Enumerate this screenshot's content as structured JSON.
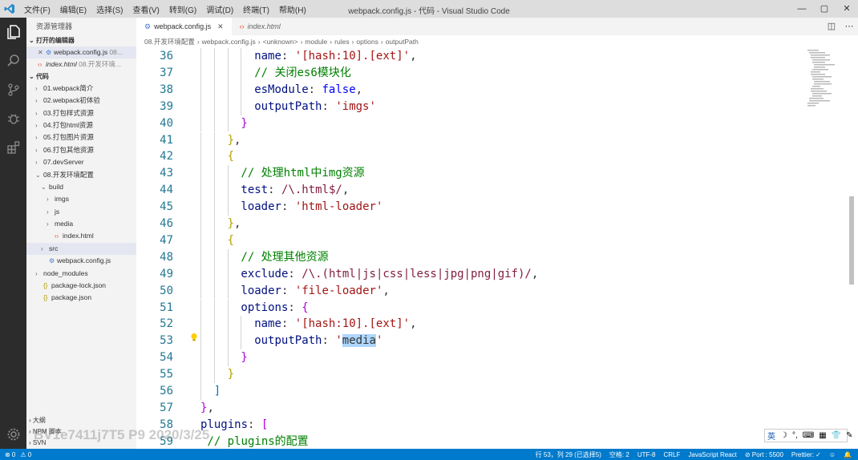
{
  "titlebar": {
    "menu": [
      "文件(F)",
      "编辑(E)",
      "选择(S)",
      "查看(V)",
      "转到(G)",
      "调试(D)",
      "终端(T)",
      "帮助(H)"
    ],
    "title": "webpack.config.js - 代码 - Visual Studio Code"
  },
  "sidebar": {
    "title": "资源管理器",
    "open_editors_label": "打开的编辑器",
    "open_editors": [
      {
        "name": "webpack.config.js",
        "path": "08..."
      },
      {
        "name": "index.html",
        "path": "08.开发环境..."
      }
    ],
    "workspace_label": "代码",
    "tree": [
      {
        "label": "01.webpack简介",
        "indent": 1,
        "chevron": "›",
        "icon": ""
      },
      {
        "label": "02.webpack初体验",
        "indent": 1,
        "chevron": "›",
        "icon": ""
      },
      {
        "label": "03.打包样式资源",
        "indent": 1,
        "chevron": "›",
        "icon": ""
      },
      {
        "label": "04.打包html资源",
        "indent": 1,
        "chevron": "›",
        "icon": ""
      },
      {
        "label": "05.打包图片资源",
        "indent": 1,
        "chevron": "›",
        "icon": ""
      },
      {
        "label": "06.打包其他资源",
        "indent": 1,
        "chevron": "›",
        "icon": ""
      },
      {
        "label": "07.devServer",
        "indent": 1,
        "chevron": "›",
        "icon": ""
      },
      {
        "label": "08.开发环境配置",
        "indent": 1,
        "chevron": "⌄",
        "icon": ""
      },
      {
        "label": "build",
        "indent": 2,
        "chevron": "⌄",
        "icon": ""
      },
      {
        "label": "imgs",
        "indent": 3,
        "chevron": "›",
        "icon": ""
      },
      {
        "label": "js",
        "indent": 3,
        "chevron": "›",
        "icon": ""
      },
      {
        "label": "media",
        "indent": 3,
        "chevron": "›",
        "icon": ""
      },
      {
        "label": "index.html",
        "indent": 3,
        "chevron": "",
        "icon": "<>"
      },
      {
        "label": "src",
        "indent": 2,
        "chevron": "›",
        "icon": "",
        "selected": true
      },
      {
        "label": "webpack.config.js",
        "indent": 2,
        "chevron": "",
        "icon": "⚙"
      },
      {
        "label": "node_modules",
        "indent": 1,
        "chevron": "›",
        "icon": ""
      },
      {
        "label": "package-lock.json",
        "indent": 1,
        "chevron": "",
        "icon": "{}"
      },
      {
        "label": "package.json",
        "indent": 1,
        "chevron": "",
        "icon": "{}"
      }
    ],
    "bottom_sections": [
      "大纲",
      "NPM 脚本",
      "SVN"
    ]
  },
  "tabs": [
    {
      "label": "webpack.config.js",
      "active": true
    },
    {
      "label": "index.html",
      "active": false
    }
  ],
  "breadcrumb": [
    "08.开发环境配置",
    "webpack.config.js",
    "<unknown>",
    "module",
    "rules",
    "options",
    "outputPath"
  ],
  "code_lines": [
    {
      "n": "36",
      "indent": 4,
      "tokens": [
        [
          "k",
          "name"
        ],
        [
          "p",
          ": "
        ],
        [
          "s",
          "'[hash:10].[ext]'"
        ],
        [
          "p",
          ","
        ]
      ]
    },
    {
      "n": "37",
      "indent": 4,
      "tokens": [
        [
          "c",
          "// 关闭es6模块化"
        ]
      ]
    },
    {
      "n": "38",
      "indent": 4,
      "tokens": [
        [
          "k",
          "esModule"
        ],
        [
          "p",
          ": "
        ],
        [
          "kw",
          "false"
        ],
        [
          "p",
          ","
        ]
      ]
    },
    {
      "n": "39",
      "indent": 4,
      "tokens": [
        [
          "k",
          "outputPath"
        ],
        [
          "p",
          ": "
        ],
        [
          "s",
          "'imgs'"
        ]
      ]
    },
    {
      "n": "40",
      "indent": 3,
      "tokens": [
        [
          "b2",
          "}"
        ]
      ]
    },
    {
      "n": "41",
      "indent": 2,
      "tokens": [
        [
          "b1",
          "}"
        ],
        [
          "p",
          ","
        ]
      ]
    },
    {
      "n": "42",
      "indent": 2,
      "tokens": [
        [
          "b1",
          "{"
        ]
      ]
    },
    {
      "n": "43",
      "indent": 3,
      "tokens": [
        [
          "c",
          "// 处理html中img资源"
        ]
      ]
    },
    {
      "n": "44",
      "indent": 3,
      "tokens": [
        [
          "k",
          "test"
        ],
        [
          "p",
          ": "
        ],
        [
          "rx",
          "/\\.html$/"
        ],
        [
          "p",
          ","
        ]
      ]
    },
    {
      "n": "45",
      "indent": 3,
      "tokens": [
        [
          "k",
          "loader"
        ],
        [
          "p",
          ": "
        ],
        [
          "s",
          "'html-loader'"
        ]
      ]
    },
    {
      "n": "46",
      "indent": 2,
      "tokens": [
        [
          "b1",
          "}"
        ],
        [
          "p",
          ","
        ]
      ]
    },
    {
      "n": "47",
      "indent": 2,
      "tokens": [
        [
          "b1",
          "{"
        ]
      ]
    },
    {
      "n": "48",
      "indent": 3,
      "tokens": [
        [
          "c",
          "// 处理其他资源"
        ]
      ]
    },
    {
      "n": "49",
      "indent": 3,
      "tokens": [
        [
          "k",
          "exclude"
        ],
        [
          "p",
          ": "
        ],
        [
          "rx",
          "/\\.(html|js|css|less|jpg|png|gif)/"
        ],
        [
          "p",
          ","
        ]
      ]
    },
    {
      "n": "50",
      "indent": 3,
      "tokens": [
        [
          "k",
          "loader"
        ],
        [
          "p",
          ": "
        ],
        [
          "s",
          "'file-loader'"
        ],
        [
          "p",
          ","
        ]
      ]
    },
    {
      "n": "51",
      "indent": 3,
      "tokens": [
        [
          "k",
          "options"
        ],
        [
          "p",
          ": "
        ],
        [
          "b2",
          "{"
        ]
      ]
    },
    {
      "n": "52",
      "indent": 4,
      "tokens": [
        [
          "k",
          "name"
        ],
        [
          "p",
          ": "
        ],
        [
          "s",
          "'[hash:10].[ext]'"
        ],
        [
          "p",
          ","
        ]
      ]
    },
    {
      "n": "53",
      "indent": 4,
      "tokens": [
        [
          "k",
          "outputPath"
        ],
        [
          "p",
          ": "
        ],
        [
          "s",
          "'"
        ],
        [
          "sel",
          "media"
        ],
        [
          "s",
          "'"
        ]
      ]
    },
    {
      "n": "54",
      "indent": 3,
      "tokens": [
        [
          "b2",
          "}"
        ]
      ]
    },
    {
      "n": "55",
      "indent": 2,
      "tokens": [
        [
          "b1",
          "}"
        ]
      ]
    },
    {
      "n": "56",
      "indent": 1,
      "tokens": [
        [
          "b3",
          "]"
        ]
      ]
    },
    {
      "n": "57",
      "indent": 0,
      "tokens": [
        [
          "b2",
          "}"
        ],
        [
          "p",
          ","
        ]
      ]
    },
    {
      "n": "58",
      "indent": 0,
      "tokens": [
        [
          "k",
          "plugins"
        ],
        [
          "p",
          ": "
        ],
        [
          "b2",
          "["
        ]
      ]
    },
    {
      "n": "59",
      "indent": 0.5,
      "tokens": [
        [
          "c",
          "// plugins的配置"
        ]
      ]
    }
  ],
  "statusbar": {
    "left": [
      "⊗ 0",
      "⚠ 0"
    ],
    "right": [
      "行 53，列 29 (已选择5)",
      "空格: 2",
      "UTF-8",
      "CRLF",
      "JavaScript React",
      "⊘ Port : 5500",
      "Prettier: ✓",
      "☺",
      "🔔"
    ]
  },
  "ime": [
    "英",
    "☽",
    "°,",
    "⌨",
    "▦",
    "👕",
    "✎"
  ],
  "watermark": "BV1e7411j7T5 P9 2020/3/25",
  "colors": {
    "accent": "#007acc",
    "activitybar": "#2c2c2c",
    "sidebar": "#f3f3f3"
  }
}
